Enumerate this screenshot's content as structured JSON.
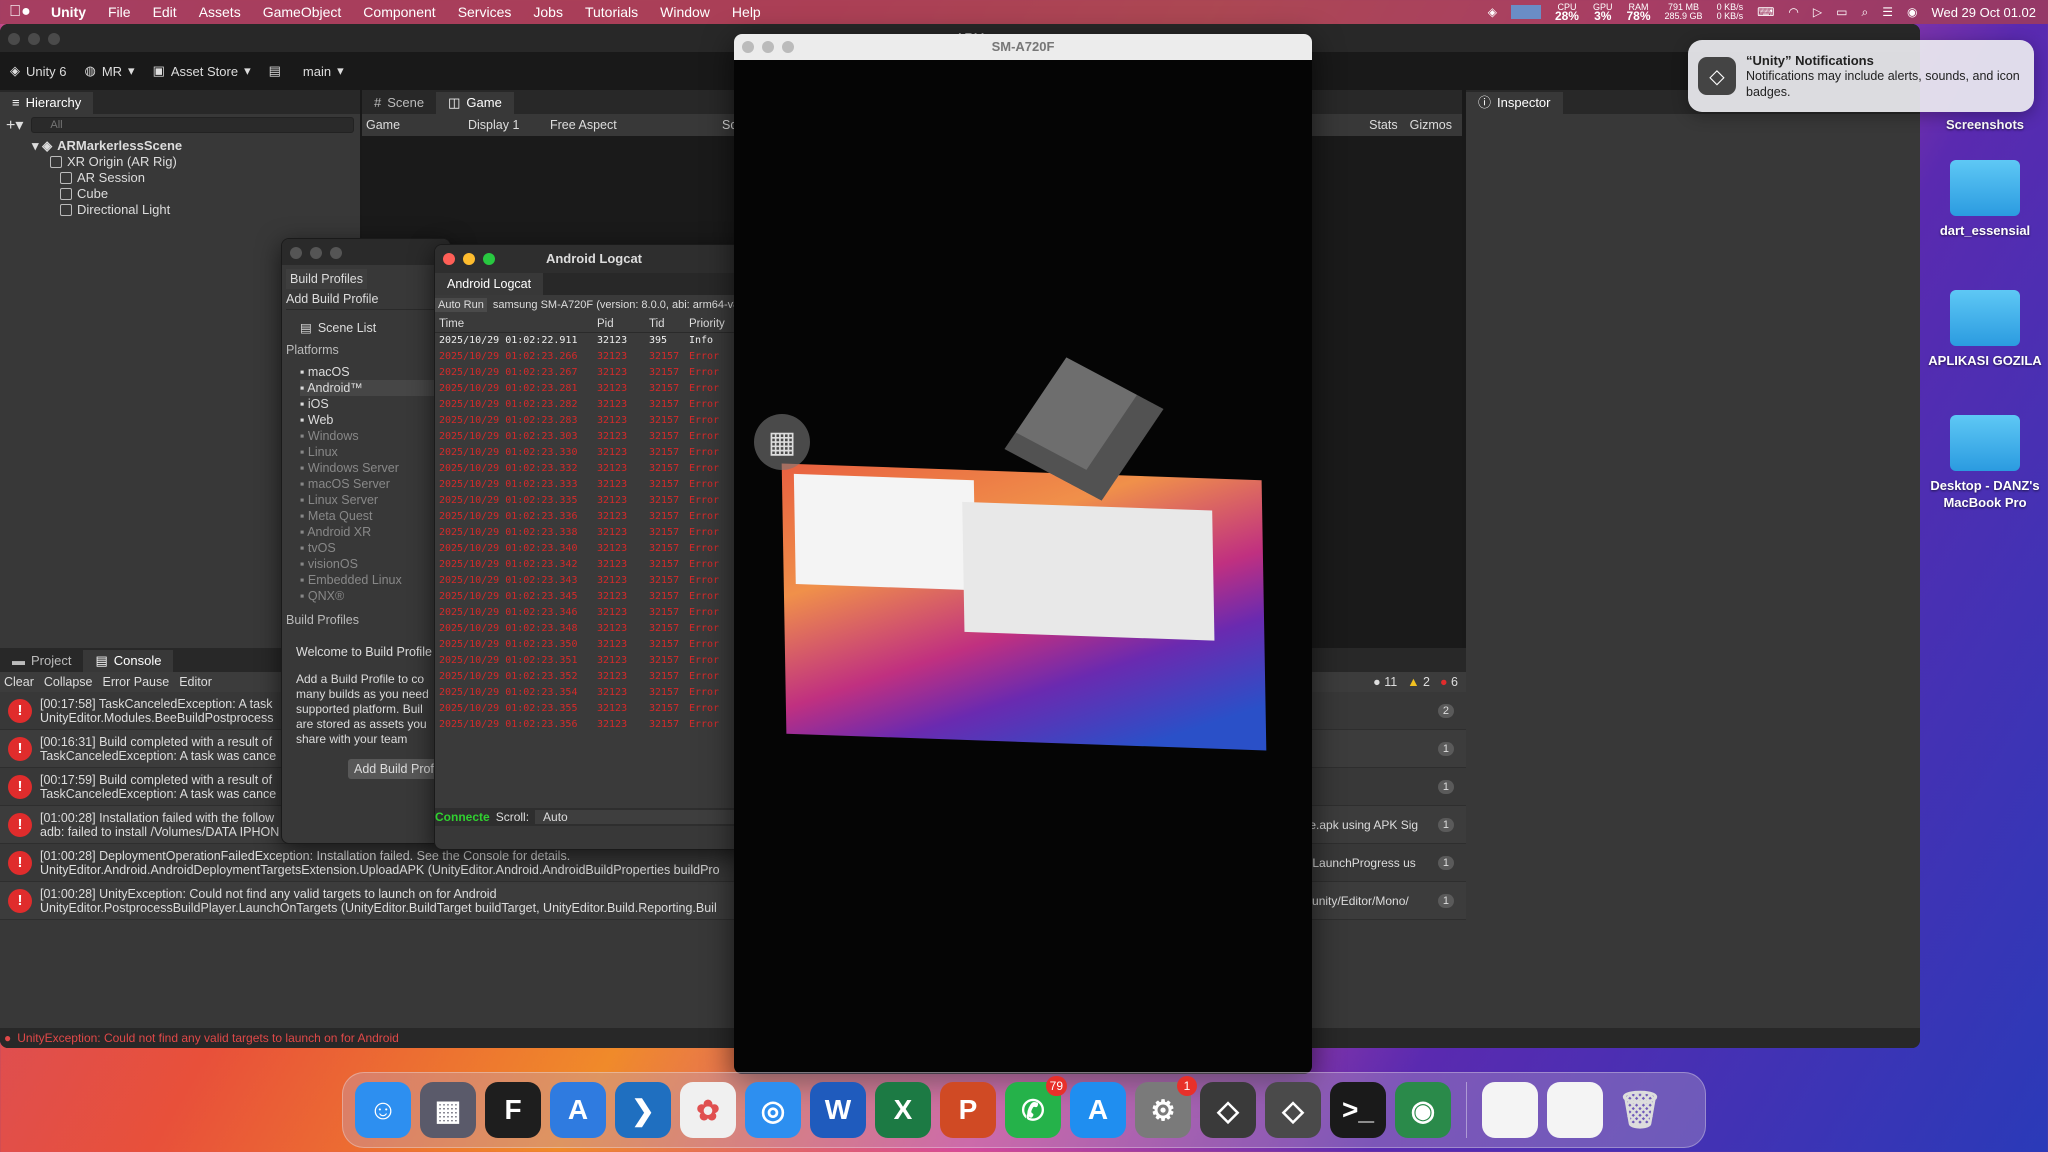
{
  "menubar": {
    "items": [
      "Unity",
      "File",
      "Edit",
      "Assets",
      "GameObject",
      "Component",
      "Services",
      "Jobs",
      "Tutorials",
      "Window",
      "Help"
    ],
    "cpu_label": "CPU",
    "cpu_value": "28%",
    "gpu_label": "GPU",
    "gpu_value": "3%",
    "ram_label": "RAM",
    "ram_value": "78%",
    "mem_top": "791 MB",
    "mem_bottom": "285.9 GB",
    "net_top": "0 KB/s",
    "net_bottom": "0 KB/s",
    "clock": "Wed 29 Oct  01.02"
  },
  "unity": {
    "title": "ARM",
    "toolbar": {
      "version": "Unity 6",
      "account": "MR",
      "asset_store": "Asset Store",
      "branch": "main"
    },
    "hierarchy": {
      "tab": "Hierarchy",
      "search_placeholder": "All",
      "scene": "ARMarkerlessScene",
      "objects": [
        "XR Origin (AR Rig)",
        "AR Session",
        "Cube",
        "Directional Light"
      ]
    },
    "scene_tabs": [
      "Scene",
      "Game"
    ],
    "game_toolbar": {
      "mode": "Game",
      "display": "Display 1",
      "aspect": "Free Aspect",
      "scale": "Scale",
      "stats": "Stats",
      "gizmos": "Gizmos"
    },
    "inspector_tab": "Inspector",
    "bottom_tabs": [
      "Project",
      "Console"
    ],
    "console_toolbar": {
      "clear": "Clear",
      "collapse": "Collapse",
      "error_pause": "Error Pause",
      "editor": "Editor",
      "info_count": "11",
      "warn_count": "2",
      "err_count": "6"
    },
    "console_lines": [
      {
        "l1": "[00:17:58] TaskCanceledException: A task",
        "l2": "UnityEditor.Modules.BeeBuildPostprocess",
        "right": "",
        "count": "2"
      },
      {
        "l1": "[00:16:31] Build completed with a result of",
        "l2": "TaskCanceledException: A task was cance",
        "right": "",
        "count": "1"
      },
      {
        "l1": "[00:17:59] Build completed with a result of",
        "l2": "TaskCanceledException: A task was cance",
        "right": "",
        "count": "1"
      },
      {
        "l1": "[01:00:28] Installation failed with the follow",
        "l2": "adb: failed to install /Volumes/DATA IPHON",
        "right": "mp/base.apk using APK Sig",
        "count": "1"
      },
      {
        "l1": "[01:00:28] DeploymentOperationFailedException: Installation failed. See the Console for details.",
        "l2": "UnityEditor.Android.AndroidDeploymentTargetsExtension.UploadAPK (UnityEditor.Android.AndroidBuildProperties buildPro",
        "right": "ension+LaunchProgress us",
        "count": "1"
      },
      {
        "l1": "[01:00:28] UnityException: Could not find any valid targets to launch on for Android",
        "l2": "UnityEditor.PostprocessBuildPlayer.LaunchOnTargets (UnityEditor.BuildTarget buildTarget, UnityEditor.Build.Reporting.Buil",
        "right": "ut/unity/unity/Editor/Mono/",
        "count": "1"
      }
    ],
    "status": "UnityException: Could not find any valid targets to launch on for Android"
  },
  "build_profiles": {
    "tab": "Build Profiles",
    "add": "Add Build Profile",
    "scene_list": "Scene List",
    "platforms_header": "Platforms",
    "platforms": [
      "macOS",
      "Android™",
      "iOS",
      "Web",
      "Windows",
      "Linux",
      "Windows Server",
      "macOS Server",
      "Linux Server",
      "Meta Quest",
      "Android XR",
      "tvOS",
      "visionOS",
      "Embedded Linux",
      "QNX®"
    ],
    "profiles_header": "Build Profiles",
    "welcome": "Welcome to Build Profile",
    "desc": "Add a Build Profile to co many builds as you need supported platform. Buil are stored as assets you share with your team",
    "add_button": "Add Build Profil"
  },
  "logcat": {
    "title": "Android Logcat",
    "tab": "Android Logcat",
    "auto_run": "Auto Run",
    "device": "samsung SM-A720F (version: 8.0.0, abi: arm64-v8a, sdk",
    "headers": [
      "Time",
      "Pid",
      "Tid",
      "Priority",
      "T"
    ],
    "first": {
      "time": "2025/10/29 01:02:22.911",
      "pid": "32123",
      "tid": "395",
      "priority": "Info"
    },
    "error_time_prefix": "2025/10/29 01:02:2",
    "error_pid": "32123",
    "error_tid": "32157",
    "error_priority": "Error",
    "connected": "Connecte",
    "scroll_label": "Scroll:",
    "scroll_value": "Auto"
  },
  "device_window": {
    "title": "SM-A720F"
  },
  "notification": {
    "title": "“Unity” Notifications",
    "body": "Notifications may include alerts, sounds, and icon badges."
  },
  "desktop": {
    "screenshots": "Screenshots",
    "icons": [
      {
        "label": "dart_essensial"
      },
      {
        "label": "APLIKASI GOZILA"
      },
      {
        "label": "Desktop - DANZ's MacBook Pro"
      }
    ]
  },
  "dock": {
    "apps": [
      {
        "name": "Finder",
        "glyph": "☺",
        "color": "#2d8ff0"
      },
      {
        "name": "Launchpad",
        "glyph": "▦",
        "color": "#5a5a6a"
      },
      {
        "name": "Figma",
        "glyph": "F",
        "color": "#1e1e1e"
      },
      {
        "name": "Xcode",
        "glyph": "A",
        "color": "#2f7be0"
      },
      {
        "name": "VS Code",
        "glyph": "❯",
        "color": "#1f6fc0"
      },
      {
        "name": "Photos",
        "glyph": "✿",
        "color": "#f0f0f0"
      },
      {
        "name": "Safari",
        "glyph": "◎",
        "color": "#2d8ff0"
      },
      {
        "name": "Word",
        "glyph": "W",
        "color": "#1f5bbd"
      },
      {
        "name": "Excel",
        "glyph": "X",
        "color": "#1c7a44"
      },
      {
        "name": "PowerPoint",
        "glyph": "P",
        "color": "#d04a24"
      },
      {
        "name": "WhatsApp",
        "glyph": "✆",
        "color": "#25b24a",
        "badge": "79"
      },
      {
        "name": "App Store",
        "glyph": "A",
        "color": "#1f8ef0"
      },
      {
        "name": "System Settings",
        "glyph": "⚙",
        "color": "#7a7a7a",
        "badge": "1"
      },
      {
        "name": "Unity Hub",
        "glyph": "◇",
        "color": "#3a3a3a"
      },
      {
        "name": "Unity 6",
        "glyph": "◇",
        "color": "#4a4a4a"
      },
      {
        "name": "Terminal",
        "glyph": ">_",
        "color": "#1a1a1a"
      },
      {
        "name": "Android Studio",
        "glyph": "◉",
        "color": "#2a8a4a"
      }
    ]
  },
  "colors": {
    "error": "#d42a2a",
    "accent": "#2d8ff0",
    "editor_bg": "#383838"
  }
}
